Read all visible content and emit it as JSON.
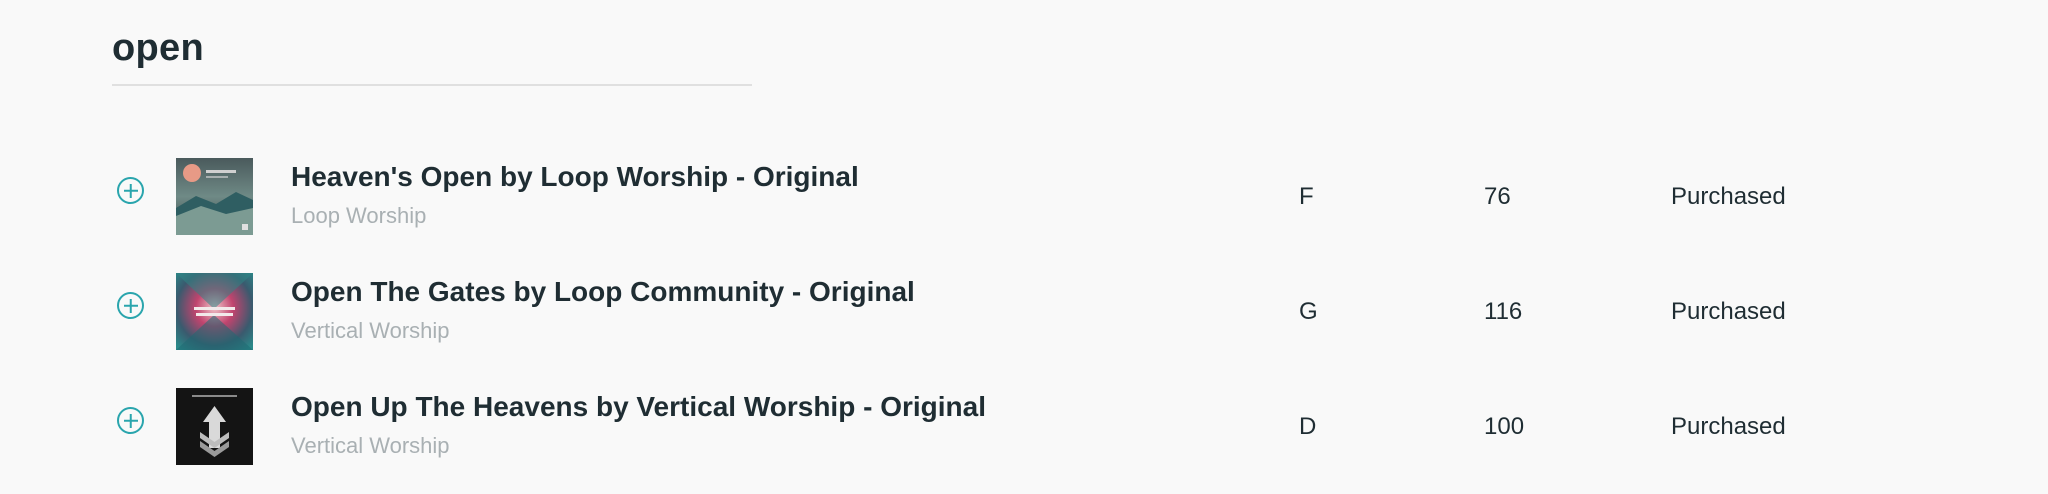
{
  "search": {
    "query": "open"
  },
  "results": [
    {
      "title": "Heaven's Open by Loop Worship - Original",
      "artist": "Loop Worship",
      "key": "F",
      "bpm": "76",
      "status": "Purchased"
    },
    {
      "title": "Open The Gates by Loop Community - Original",
      "artist": "Vertical Worship",
      "key": "G",
      "bpm": "116",
      "status": "Purchased"
    },
    {
      "title": "Open Up The Heavens by Vertical Worship - Original",
      "artist": "Vertical Worship",
      "key": "D",
      "bpm": "100",
      "status": "Purchased"
    }
  ],
  "colors": {
    "accent": "#2aa5ad",
    "text": "#1f2d33",
    "muted": "#a9b0b3",
    "background": "#f9f9f9"
  },
  "icons": {
    "add": "plus-circle-icon"
  }
}
